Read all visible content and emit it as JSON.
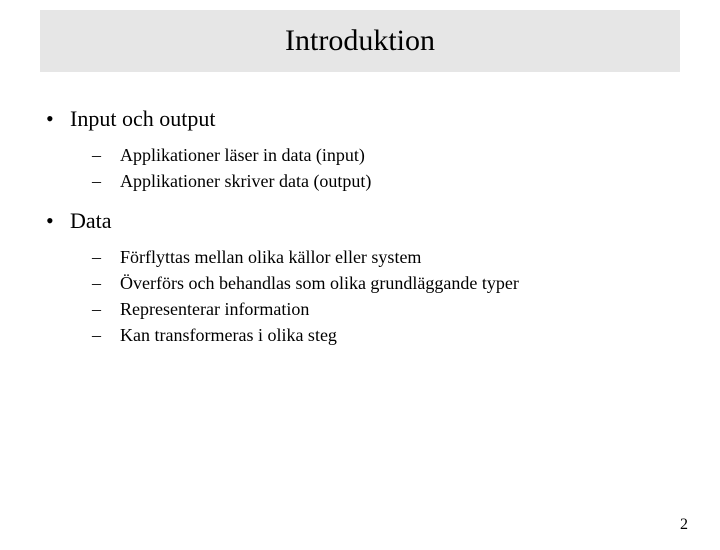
{
  "title": "Introduktion",
  "bullets": [
    {
      "label": "Input och output",
      "sub": [
        "Applikationer läser in data (input)",
        "Applikationer skriver data (output)"
      ]
    },
    {
      "label": "Data",
      "sub": [
        "Förflyttas mellan olika källor eller system",
        "Överförs och behandlas som olika grundläggande typer",
        "Representerar information",
        "Kan transformeras i olika steg"
      ]
    }
  ],
  "page_number": "2"
}
